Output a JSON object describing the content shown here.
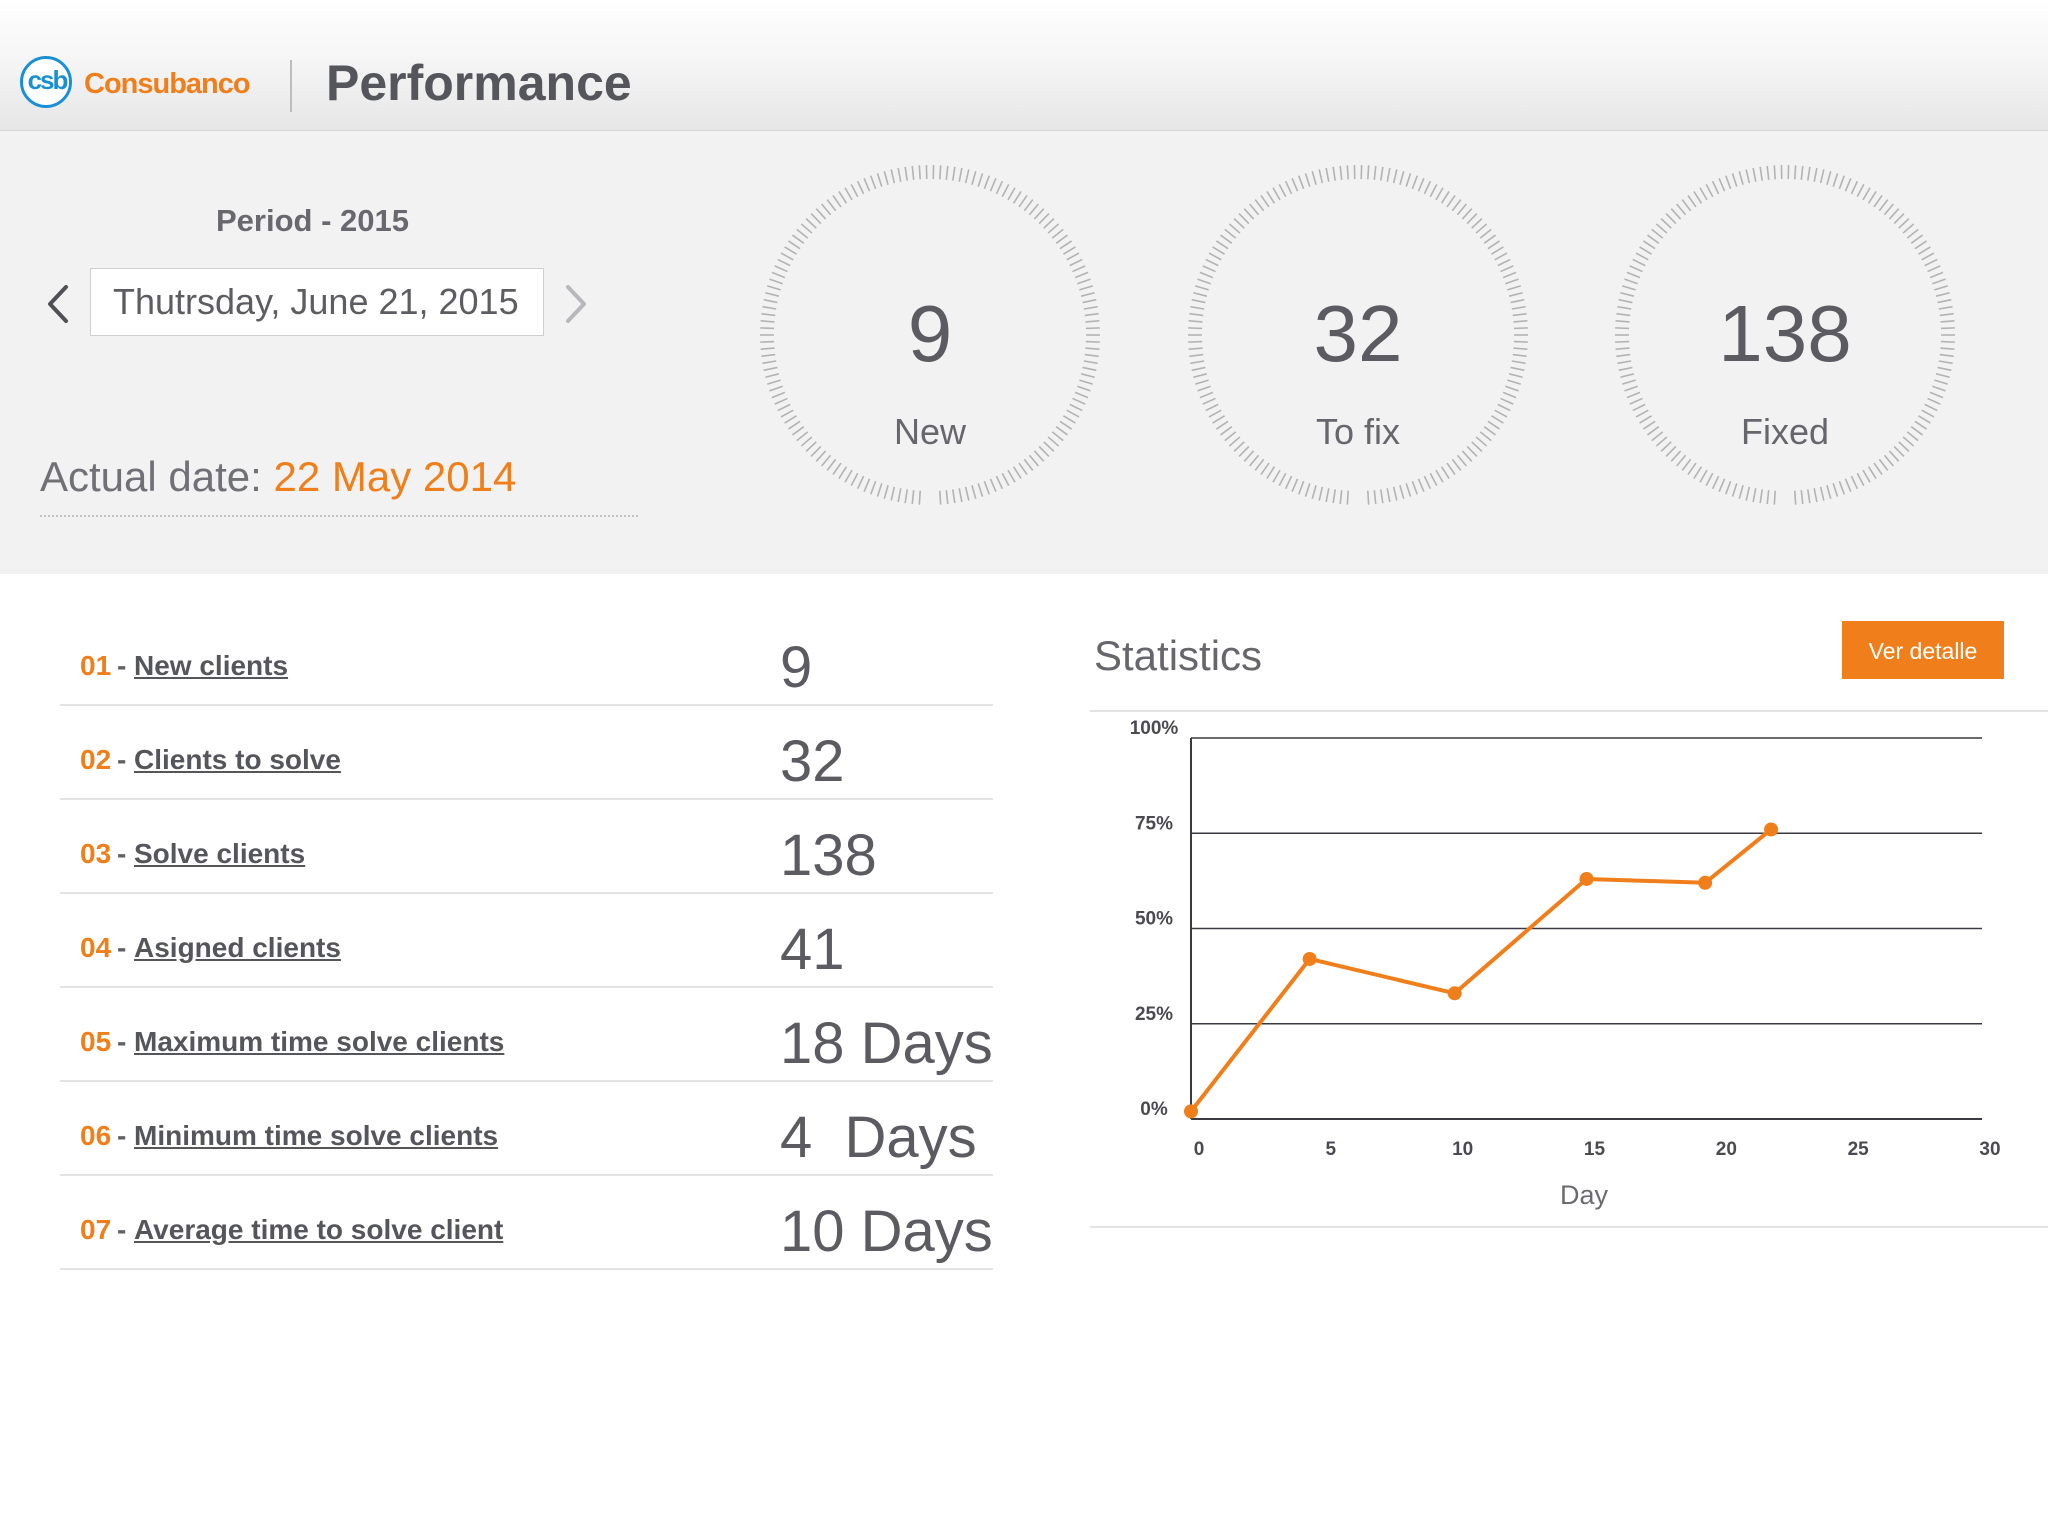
{
  "header": {
    "logo_text": "csb",
    "brand": "Consubanco",
    "title": "Performance"
  },
  "period": {
    "label": "Period - 2015",
    "date_value": "Thutrsday, June 21, 2015",
    "prev_icon": "chevron-left-icon",
    "next_icon": "chevron-right-icon"
  },
  "actual_date": {
    "label": "Actual date:",
    "value": "22 May 2014"
  },
  "gauges": [
    {
      "value": "9",
      "label": "New"
    },
    {
      "value": "32",
      "label": "To fix"
    },
    {
      "value": "138",
      "label": "Fixed"
    }
  ],
  "metrics": [
    {
      "num": "01",
      "label": "New clients",
      "value": "9"
    },
    {
      "num": "02",
      "label": "Clients to solve",
      "value": "32"
    },
    {
      "num": "03",
      "label": "Solve clients",
      "value": "138"
    },
    {
      "num": "04",
      "label": "Asigned clients",
      "value": "41"
    },
    {
      "num": "05",
      "label": "Maximum time solve clients",
      "value": "18 Days"
    },
    {
      "num": "06",
      "label": "Minimum time solve clients",
      "value": "4  Days"
    },
    {
      "num": "07",
      "label": "Average time to solve client",
      "value": "10 Days"
    }
  ],
  "statistics": {
    "title": "Statistics",
    "button_label": "Ver detalle"
  },
  "colors": {
    "accent": "#f07f1b",
    "brand_blue": "#1a8fd6",
    "panel_bg": "#f2f2f2"
  },
  "chart_data": {
    "type": "line",
    "xlabel": "Day",
    "ylabel": "",
    "x_ticks": [
      0,
      5,
      10,
      15,
      20,
      25,
      30
    ],
    "y_ticks": [
      "0%",
      "25%",
      "50%",
      "75%",
      "100%"
    ],
    "xlim": [
      0,
      30
    ],
    "ylim": [
      0,
      100
    ],
    "grid": true,
    "series": [
      {
        "x": [
          0,
          4.5,
          10,
          15,
          19.5,
          22
        ],
        "y": [
          2,
          42,
          33,
          63,
          62,
          76
        ]
      }
    ]
  }
}
